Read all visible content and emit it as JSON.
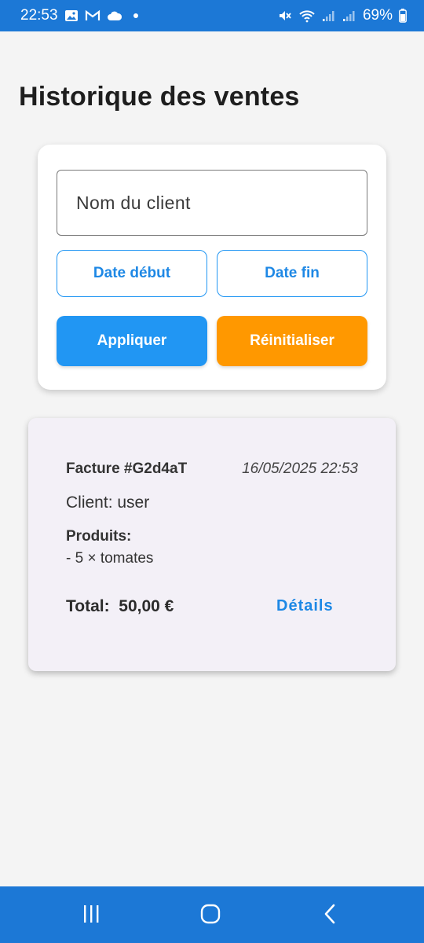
{
  "status_bar": {
    "time": "22:53",
    "battery": "69%",
    "icons_left": [
      "image-icon",
      "gmail-icon",
      "cloud-icon",
      "dot-icon"
    ],
    "icons_right": [
      "mute-icon",
      "wifi-icon",
      "signal-icon",
      "signal-icon-2",
      "battery-icon"
    ]
  },
  "page": {
    "title": "Historique des ventes"
  },
  "filters": {
    "client_placeholder": "Nom du client",
    "client_value": "",
    "date_start_label": "Date début",
    "date_end_label": "Date fin",
    "apply_label": "Appliquer",
    "reset_label": "Réinitialiser"
  },
  "invoices": [
    {
      "number": "Facture #G2d4aT",
      "date": "16/05/2025 22:53",
      "client": "Client: user",
      "products_label": "Produits:",
      "products": [
        "- 5 × tomates"
      ],
      "total": "Total:  50,00 €",
      "details_label": "Détails"
    }
  ],
  "nav_bar": {
    "buttons": [
      "recents-icon",
      "home-icon",
      "back-icon"
    ]
  },
  "colors": {
    "system_bar": "#1c78d6",
    "primary": "#2196f3",
    "accent": "#ff9800",
    "invoice_card_bg": "#f3f0f7",
    "page_bg": "#f4f4f4"
  }
}
